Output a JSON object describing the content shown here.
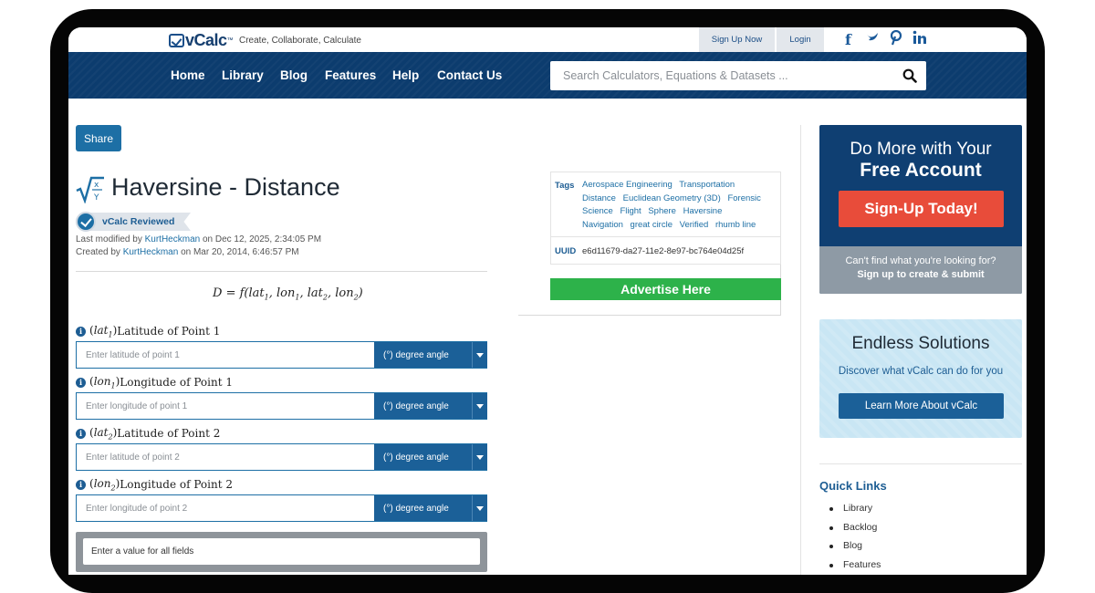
{
  "header": {
    "logo": "vCalc",
    "logo_tm": "™",
    "tagline": "Create, Collaborate, Calculate",
    "signup_link": "Sign Up Now",
    "login_link": "Login"
  },
  "social_icons": [
    "facebook-icon",
    "twitter-icon",
    "pinterest-icon",
    "linkedin-icon"
  ],
  "nav": {
    "items": [
      "Home",
      "Library",
      "Blog",
      "Features",
      "Help",
      "Contact Us"
    ],
    "search_placeholder": "Search Calculators, Equations & Datasets ..."
  },
  "page": {
    "share_label": "Share",
    "title": "Haversine - Distance",
    "badge": "vCalc Reviewed",
    "modified_prefix": "Last modified by",
    "modified_user": "KurtHeckman",
    "modified_date": "on Dec 12, 2025, 2:34:05 PM",
    "created_prefix": "Created by",
    "created_user": "KurtHeckman",
    "created_date": "on Mar 20, 2014, 6:46:57 PM"
  },
  "formula": {
    "lhs": "D",
    "fn": "f",
    "args": [
      {
        "base": "lat",
        "sub": "1"
      },
      {
        "base": "lon",
        "sub": "1"
      },
      {
        "base": "lat",
        "sub": "2"
      },
      {
        "base": "lon",
        "sub": "2"
      }
    ]
  },
  "fields": [
    {
      "var": "lat",
      "sub": "1",
      "label": "Latitude of Point 1",
      "placeholder": "Enter latitude of point 1",
      "unit": "(°) degree angle"
    },
    {
      "var": "lon",
      "sub": "1",
      "label": "Longitude of Point 1",
      "placeholder": "Enter longitude of point 1",
      "unit": "(°) degree angle"
    },
    {
      "var": "lat",
      "sub": "2",
      "label": "Latitude of Point 2",
      "placeholder": "Enter latitude of point 2",
      "unit": "(°) degree angle"
    },
    {
      "var": "lon",
      "sub": "2",
      "label": "Longitude of Point 2",
      "placeholder": "Enter longitude of point 2",
      "unit": "(°) degree angle"
    }
  ],
  "result_text": "Enter a value for all fields",
  "tags": {
    "label": "Tags",
    "items": [
      "Aerospace Engineering",
      "Transportation",
      "Distance",
      "Euclidean Geometry (3D)",
      "Forensic Science",
      "Flight",
      "Sphere",
      "Haversine",
      "Navigation",
      "great circle",
      "Verified",
      "rhumb line"
    ],
    "uuid_label": "UUID",
    "uuid": "e6d11679-da27-11e2-8e97-bc764e04d25f"
  },
  "advertise": "Advertise Here",
  "promo": {
    "line1": "Do More with Your",
    "line2": "Free Account",
    "button": "Sign-Up Today!",
    "sub1": "Can't find what you're looking for?",
    "sub2": "Sign up to create & submit"
  },
  "promo2": {
    "title": "Endless Solutions",
    "sub": "Discover what vCalc can do for you",
    "button": "Learn More About vCalc"
  },
  "quick_links": {
    "title": "Quick Links",
    "items": [
      "Library",
      "Backlog",
      "Blog",
      "Features"
    ]
  },
  "colors": {
    "nav_bg": "#0c3c6e",
    "accent": "#1d6fa5",
    "signup": "#e84c3a",
    "advertise": "#2db24a"
  }
}
